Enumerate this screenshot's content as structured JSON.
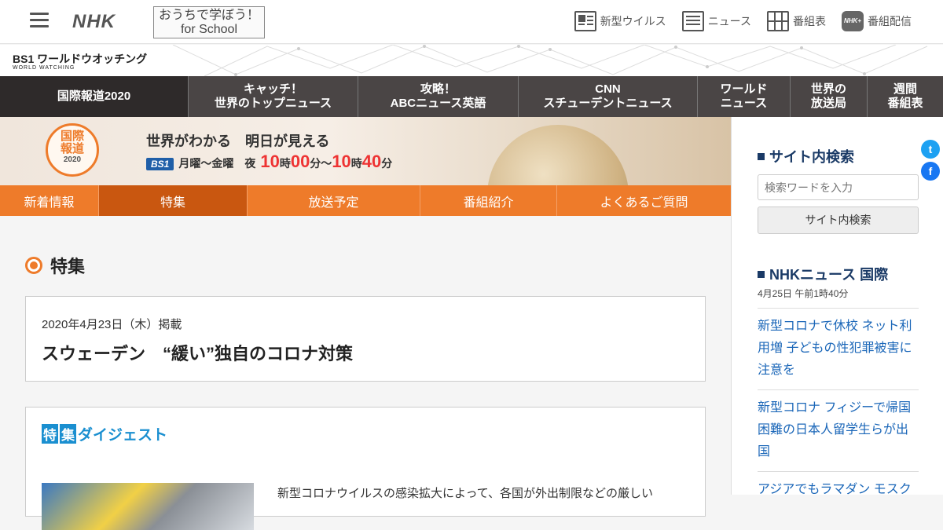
{
  "header": {
    "logo": "NHK",
    "school_line1": "おうちで学ぼう！",
    "school_line2": "for School",
    "nav": [
      {
        "label": "新型ウイルス",
        "icon": "virus-news-icon"
      },
      {
        "label": "ニュース",
        "icon": "news-icon"
      },
      {
        "label": "番組表",
        "icon": "program-grid-icon"
      },
      {
        "label": "番組配信",
        "icon": "nhk-plus-icon"
      }
    ],
    "plus_icon_text": "NHK+"
  },
  "brand": {
    "logo_main": "BS1 ワールドウオッチング",
    "logo_sub": "WORLD WATCHING"
  },
  "main_nav": [
    {
      "line1": "国際報道2020",
      "line2": ""
    },
    {
      "line1": "キャッチ！",
      "line2": "世界のトップニュース"
    },
    {
      "line1": "攻略！",
      "line2": "ABCニュース英語"
    },
    {
      "line1": "CNN",
      "line2": "スチューデントニュース"
    },
    {
      "line1": "ワールド",
      "line2": "ニュース"
    },
    {
      "line1": "世界の",
      "line2": "放送局"
    },
    {
      "line1": "週間",
      "line2": "番組表"
    }
  ],
  "hero": {
    "badge_line1": "国際",
    "badge_line2": "報道",
    "badge_year": "2020",
    "tagline": "世界がわかる　明日が見える",
    "channel": "BS1",
    "days": "月曜～金曜",
    "time_prefix": "夜",
    "h1": "10",
    "u1": "時",
    "m1": "00",
    "u2": "分～",
    "h2": "10",
    "u3": "時",
    "m2": "40",
    "u4": "分"
  },
  "sub_nav": [
    "新着情報",
    "特集",
    "放送予定",
    "番組紹介",
    "よくあるご質問"
  ],
  "content": {
    "section_title": "特集",
    "article_date": "2020年4月23日（木）掲載",
    "article_title": "スウェーデン　“緩い”独自のコロナ対策",
    "digest_box1": "特",
    "digest_box2": "集",
    "digest_rest": "ダイジェスト",
    "lead_text": "新型コロナウイルスの感染拡大によって、各国が外出制限などの厳しい"
  },
  "sidebar": {
    "search_title": "サイト内検索",
    "search_placeholder": "検索ワードを入力",
    "search_button": "サイト内検索",
    "news_title": "NHKニュース 国際",
    "news_date": "4月25日 午前1時40分",
    "news": [
      "新型コロナで休校 ネット利用増 子どもの性犯罪被害に注意を",
      "新型コロナ フィジーで帰国困難の日本人留学生らが出国",
      "アジアでもラマダン モスク"
    ]
  },
  "social": {
    "twitter": "t",
    "facebook": "f"
  },
  "colors": {
    "accent": "#ee7b2a",
    "nav_dark": "#4a4545",
    "link": "#1a66b8"
  }
}
